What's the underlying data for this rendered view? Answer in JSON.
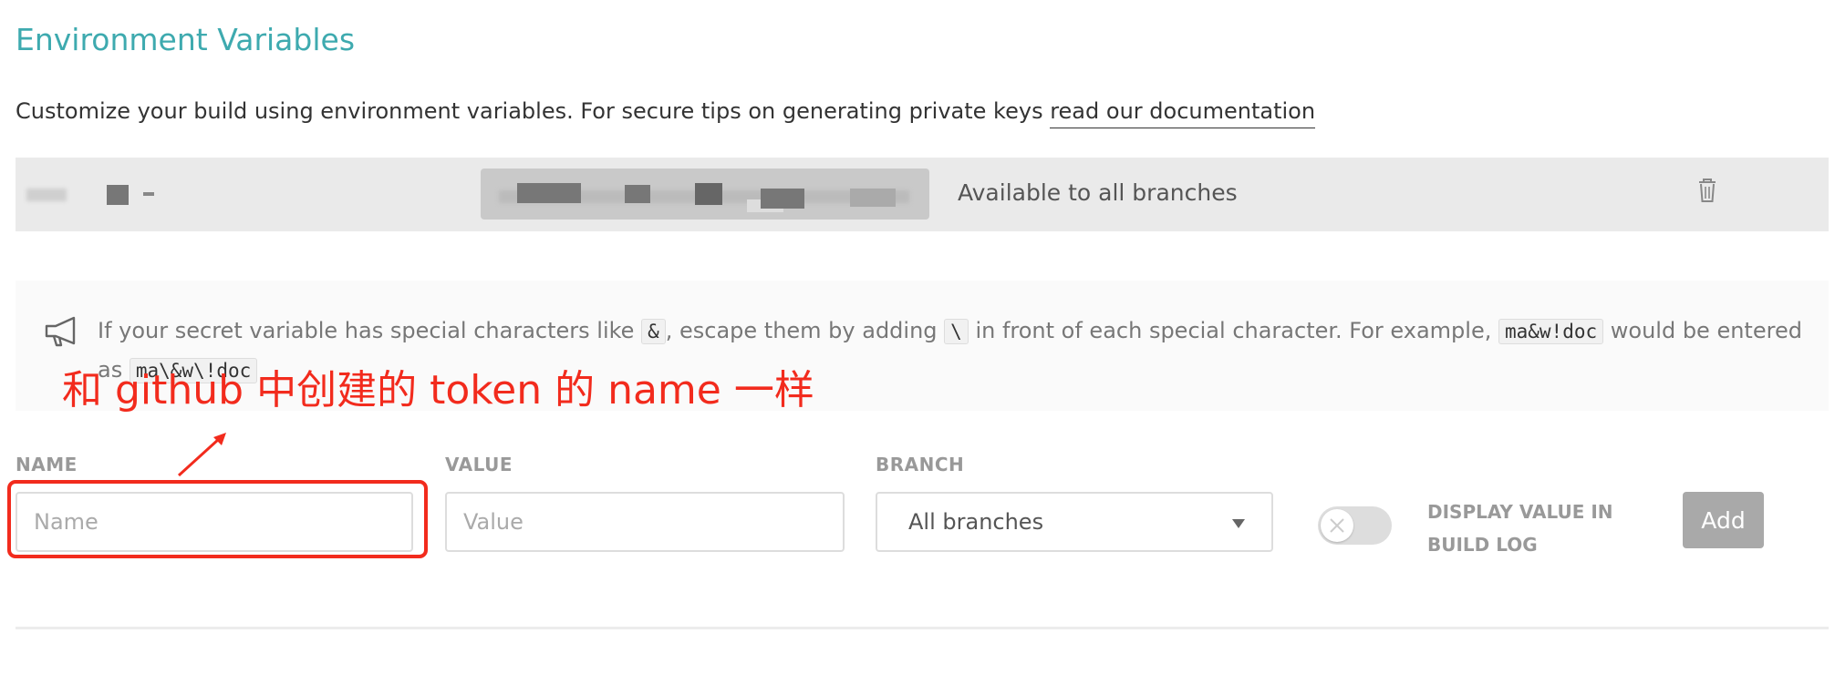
{
  "section": {
    "title": "Environment Variables",
    "description": "Customize your build using environment variables. For secure tips on generating private keys ",
    "doc_link": "read our documentation"
  },
  "existing_variable": {
    "availability": "Available to all branches"
  },
  "notice": {
    "text_1": "If your secret variable has special characters like ",
    "code_1": "&",
    "text_2": ", escape them by adding ",
    "code_2": "\\",
    "text_3": " in front of each special character. For example, ",
    "code_3": "ma&w!doc",
    "text_4": " would be entered as ",
    "code_4": "ma\\&w\\!doc"
  },
  "annotation": {
    "text": "和 github 中创建的 token 的 name 一样",
    "color": "#f22b1d"
  },
  "form": {
    "name_label": "NAME",
    "name_placeholder": "Name",
    "value_label": "VALUE",
    "value_placeholder": "Value",
    "branch_label": "BRANCH",
    "branch_selected": "All branches",
    "display_toggle_label": "DISPLAY VALUE IN BUILD LOG",
    "display_toggle_on": false,
    "add_label": "Add"
  },
  "colors": {
    "accent": "#3eaaaf",
    "button": "#a9a9a9"
  }
}
